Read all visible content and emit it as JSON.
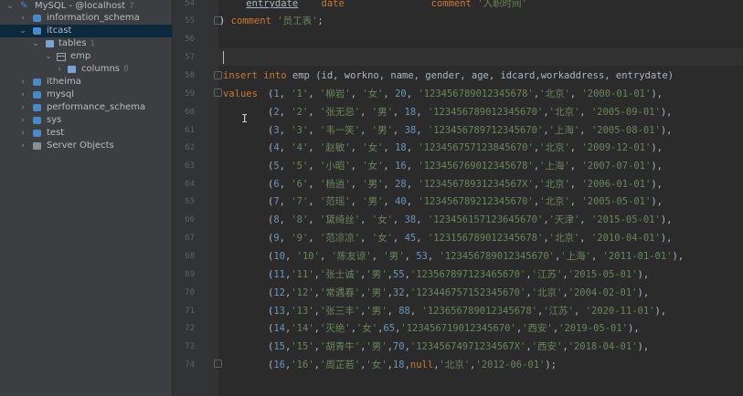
{
  "tree": [
    {
      "label": "MySQL - @localhost",
      "count": "7",
      "icon": "mysql-server-icon",
      "expanded": true
    },
    {
      "label": "information_schema",
      "count": "",
      "icon": "database-icon",
      "expanded": false
    },
    {
      "label": "itcast",
      "count": "",
      "icon": "database-icon",
      "expanded": true,
      "selected": true
    },
    {
      "label": "tables",
      "count": "1",
      "icon": "folder-icon",
      "expanded": true
    },
    {
      "label": "emp",
      "count": "",
      "icon": "table-icon",
      "expanded": true
    },
    {
      "label": "columns",
      "count": "8",
      "icon": "columns-icon",
      "expanded": false
    },
    {
      "label": "itheima",
      "count": "",
      "icon": "database-icon",
      "expanded": false
    },
    {
      "label": "mysql",
      "count": "",
      "icon": "database-icon",
      "expanded": false
    },
    {
      "label": "performance_schema",
      "count": "",
      "icon": "database-icon",
      "expanded": false
    },
    {
      "label": "sys",
      "count": "",
      "icon": "database-icon",
      "expanded": false
    },
    {
      "label": "test",
      "count": "",
      "icon": "database-icon",
      "expanded": false
    },
    {
      "label": "Server Objects",
      "count": "",
      "icon": "server-objects-icon",
      "expanded": false
    }
  ],
  "line_numbers": [
    "54",
    "55",
    "56",
    "57",
    "58",
    "59",
    "60",
    "61",
    "62",
    "63",
    "64",
    "65",
    "66",
    "67",
    "68",
    "69",
    "70",
    "71",
    "72",
    "73",
    "74"
  ],
  "code": {
    "line54": {
      "col": "entrydate",
      "type": "date",
      "kw": "comment",
      "str": "'入职时间'"
    },
    "line55": {
      "prefix": ") ",
      "kw": "comment",
      "str": "'员工表'",
      "suffix": ";"
    },
    "insert": {
      "kw1": "insert",
      "kw2": "into",
      "table": "emp",
      "cols": "(id, workno, name, gender, age, idcard,workaddress, entrydate)"
    },
    "values_kw": "values",
    "rows": [
      {
        "open": "(",
        "id": "1",
        "rest1": ", ",
        "workno": "'1'",
        "s1": ", ",
        "name": "'柳岩'",
        "s2": ", ",
        "gender": "'女'",
        "s3": ", ",
        "age": "20",
        "s4": ", ",
        "idcard": "'123456789012345678'",
        "s5": ",",
        "addr": "'北京'",
        "s6": ", ",
        "date": "'2000-01-01'",
        "close": "),"
      },
      {
        "open": "(",
        "id": "2",
        "rest1": ", ",
        "workno": "'2'",
        "s1": ", ",
        "name": "'张无忌'",
        "s2": ", ",
        "gender": "'男'",
        "s3": ", ",
        "age": "18",
        "s4": ", ",
        "idcard": "'123456789012345670'",
        "s5": ",",
        "addr": "'北京'",
        "s6": ", ",
        "date": "'2005-09-01'",
        "close": "),"
      },
      {
        "open": "(",
        "id": "3",
        "rest1": ", ",
        "workno": "'3'",
        "s1": ", ",
        "name": "'韦一笑'",
        "s2": ", ",
        "gender": "'男'",
        "s3": ", ",
        "age": "38",
        "s4": ", ",
        "idcard": "'123456789712345670'",
        "s5": ",",
        "addr": "'上海'",
        "s6": ", ",
        "date": "'2005-08-01'",
        "close": "),"
      },
      {
        "open": "(",
        "id": "4",
        "rest1": ", ",
        "workno": "'4'",
        "s1": ", ",
        "name": "'赵敏'",
        "s2": ", ",
        "gender": "'女'",
        "s3": ", ",
        "age": "18",
        "s4": ", ",
        "idcard": "'123456757123845670'",
        "s5": ",",
        "addr": "'北京'",
        "s6": ", ",
        "date": "'2009-12-01'",
        "close": "),"
      },
      {
        "open": "(",
        "id": "5",
        "rest1": ", ",
        "workno": "'5'",
        "s1": ", ",
        "name": "'小昭'",
        "s2": ", ",
        "gender": "'女'",
        "s3": ", ",
        "age": "16",
        "s4": ", ",
        "idcard": "'123456769012345678'",
        "s5": ",",
        "addr": "'上海'",
        "s6": ", ",
        "date": "'2007-07-01'",
        "close": "),"
      },
      {
        "open": "(",
        "id": "6",
        "rest1": ", ",
        "workno": "'6'",
        "s1": ", ",
        "name": "'杨逍'",
        "s2": ", ",
        "gender": "'男'",
        "s3": ", ",
        "age": "28",
        "s4": ", ",
        "idcard": "'12345678931234567X'",
        "s5": ",",
        "addr": "'北京'",
        "s6": ", ",
        "date": "'2006-01-01'",
        "close": "),"
      },
      {
        "open": "(",
        "id": "7",
        "rest1": ", ",
        "workno": "'7'",
        "s1": ", ",
        "name": "'范瑶'",
        "s2": ", ",
        "gender": "'男'",
        "s3": ", ",
        "age": "40",
        "s4": ", ",
        "idcard": "'123456789212345670'",
        "s5": ",",
        "addr": "'北京'",
        "s6": ", ",
        "date": "'2005-05-01'",
        "close": "),"
      },
      {
        "open": "(",
        "id": "8",
        "rest1": ", ",
        "workno": "'8'",
        "s1": ", ",
        "name": "'黛绮丝'",
        "s2": ", ",
        "gender": "'女'",
        "s3": ", ",
        "age": "38",
        "s4": ", ",
        "idcard": "'123456157123645670'",
        "s5": ",",
        "addr": "'天津'",
        "s6": ", ",
        "date": "'2015-05-01'",
        "close": "),"
      },
      {
        "open": "(",
        "id": "9",
        "rest1": ", ",
        "workno": "'9'",
        "s1": ", ",
        "name": "'范凉凉'",
        "s2": ", ",
        "gender": "'女'",
        "s3": ", ",
        "age": "45",
        "s4": ", ",
        "idcard": "'123156789012345678'",
        "s5": ",",
        "addr": "'北京'",
        "s6": ", ",
        "date": "'2010-04-01'",
        "close": "),"
      },
      {
        "open": "(",
        "id": "10",
        "rest1": ", ",
        "workno": "'10'",
        "s1": ", ",
        "name": "'陈友谅'",
        "s2": ", ",
        "gender": "'男'",
        "s3": ", ",
        "age": "53",
        "s4": ", ",
        "idcard": "'123456789012345670'",
        "s5": ",",
        "addr": "'上海'",
        "s6": ", ",
        "date": "'2011-01-01'",
        "close": "),"
      },
      {
        "open": "(",
        "id": "11",
        "rest1": ",",
        "workno": "'11'",
        "s1": ",",
        "name": "'张士诚'",
        "s2": ",",
        "gender": "'男'",
        "s3": ",",
        "age": "55",
        "s4": ",",
        "idcard": "'123567897123465670'",
        "s5": ",",
        "addr": "'江苏'",
        "s6": ",",
        "date": "'2015-05-01'",
        "close": "),"
      },
      {
        "open": "(",
        "id": "12",
        "rest1": ",",
        "workno": "'12'",
        "s1": ",",
        "name": "'常遇春'",
        "s2": ",",
        "gender": "'男'",
        "s3": ",",
        "age": "32",
        "s4": ",",
        "idcard": "'123446757152345670'",
        "s5": ",",
        "addr": "'北京'",
        "s6": ",",
        "date": "'2004-02-01'",
        "close": "),"
      },
      {
        "open": "(",
        "id": "13",
        "rest1": ",",
        "workno": "'13'",
        "s1": ",",
        "name": "'张三丰'",
        "s2": ",",
        "gender": "'男'",
        "s3": ", ",
        "age": "88",
        "s4": ", ",
        "idcard": "'123656789012345678'",
        "s5": ",",
        "addr": "'江苏'",
        "s6": ", ",
        "date": "'2020-11-01'",
        "close": "),"
      },
      {
        "open": "(",
        "id": "14",
        "rest1": ",",
        "workno": "'14'",
        "s1": ",",
        "name": "'灭绝'",
        "s2": ",",
        "gender": "'女'",
        "s3": ",",
        "age": "65",
        "s4": ",",
        "idcard": "'123456719012345670'",
        "s5": ",",
        "addr": "'西安'",
        "s6": ",",
        "date": "'2019-05-01'",
        "close": "),"
      },
      {
        "open": "(",
        "id": "15",
        "rest1": ",",
        "workno": "'15'",
        "s1": ",",
        "name": "'胡青牛'",
        "s2": ",",
        "gender": "'男'",
        "s3": ",",
        "age": "70",
        "s4": ",",
        "idcard": "'12345674971234567X'",
        "s5": ",",
        "addr": "'西安'",
        "s6": ",",
        "date": "'2018-04-01'",
        "close": "),"
      },
      {
        "open": "(",
        "id": "16",
        "rest1": ",",
        "workno": "'16'",
        "s1": ",",
        "name": "'周芷若'",
        "s2": ",",
        "gender": "'女'",
        "s3": ",",
        "age": "18",
        "s4": ",",
        "idcard": "null",
        "s5": ",",
        "addr": "'北京'",
        "s6": ",",
        "date": "'2012-06-01'",
        "close": ");"
      }
    ]
  }
}
